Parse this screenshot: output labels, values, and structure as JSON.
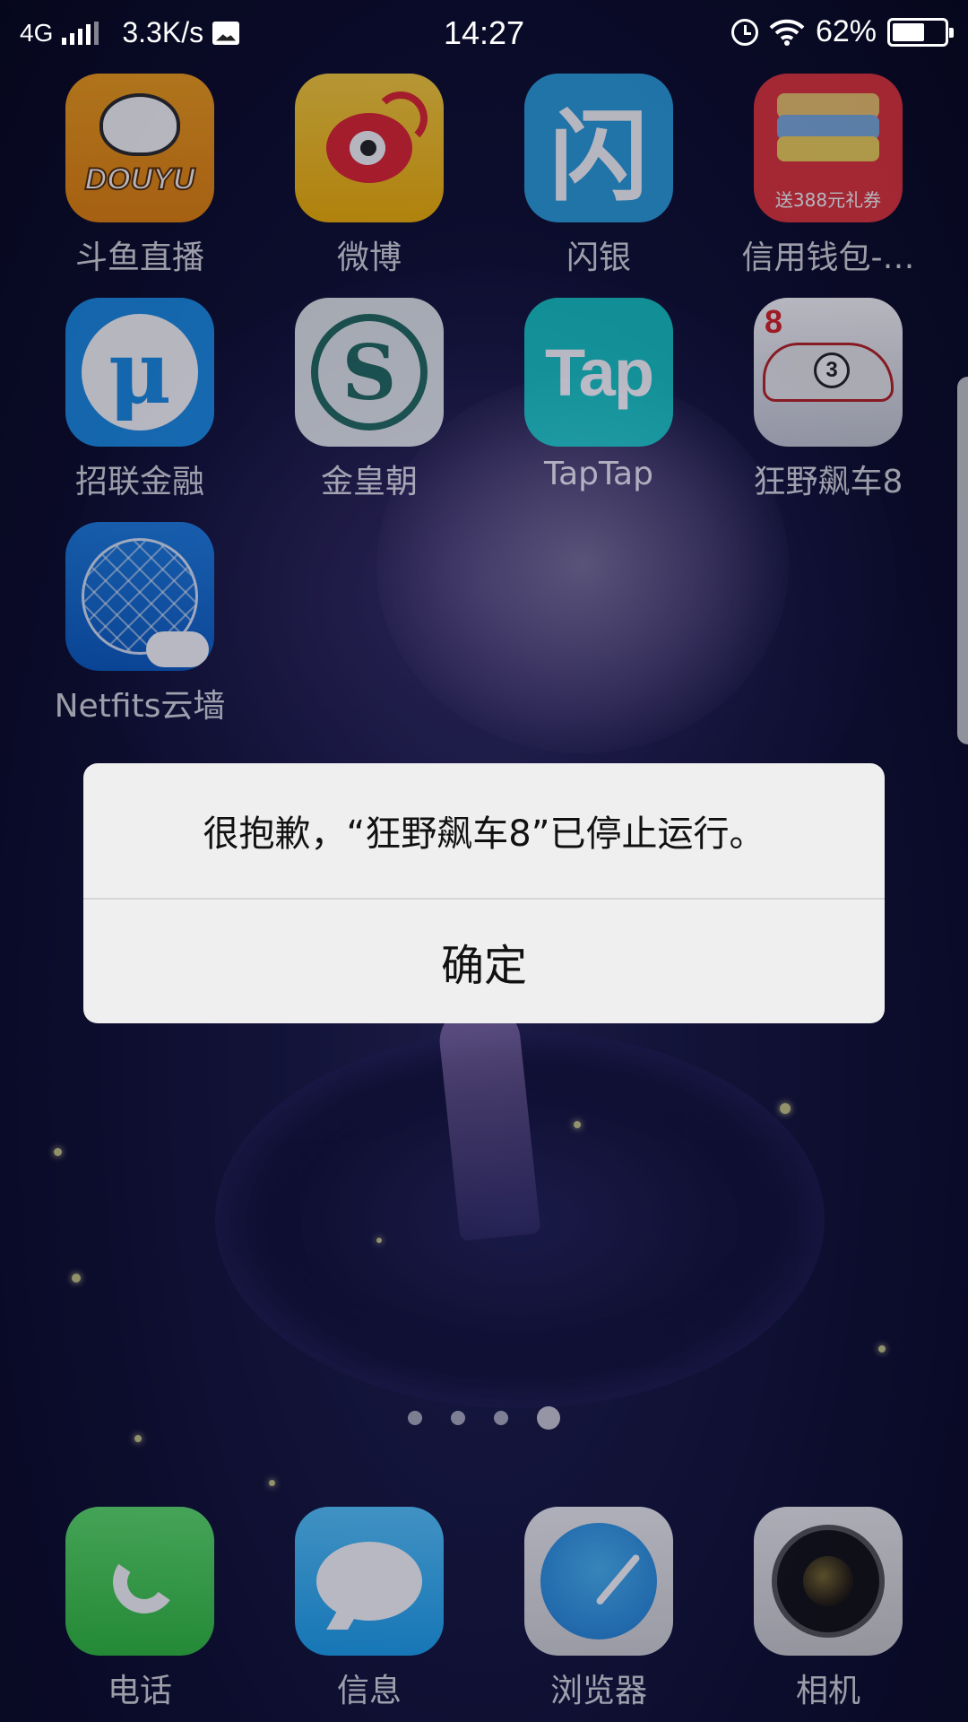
{
  "status_bar": {
    "network": "4G",
    "speed": "3.3K/s",
    "time": "14:27",
    "battery": "62%",
    "battery_level": 0.62
  },
  "apps": [
    {
      "label": "斗鱼直播",
      "icon": "douyu-icon",
      "glyph": "DOUYU"
    },
    {
      "label": "微博",
      "icon": "weibo-icon"
    },
    {
      "label": "闪银",
      "icon": "shanyin-icon",
      "glyph": "闪"
    },
    {
      "label": "信用钱包-…",
      "icon": "credit-wallet-icon",
      "glyph": "送388元礼券"
    },
    {
      "label": "招联金融",
      "icon": "zhaolian-icon",
      "glyph": "μ"
    },
    {
      "label": "金皇朝",
      "icon": "jinhuangchao-icon",
      "glyph": "S"
    },
    {
      "label": "TapTap",
      "icon": "taptap-icon",
      "glyph": "Tap"
    },
    {
      "label": "狂野飙车8",
      "icon": "asphalt8-icon",
      "glyph": "8"
    },
    {
      "label": "Netfits云墙",
      "icon": "netfits-icon"
    }
  ],
  "dock": [
    {
      "label": "电话",
      "icon": "phone-icon"
    },
    {
      "label": "信息",
      "icon": "messages-icon"
    },
    {
      "label": "浏览器",
      "icon": "browser-icon"
    },
    {
      "label": "相机",
      "icon": "camera-icon"
    }
  ],
  "page_indicator": {
    "count": 4,
    "active": 4
  },
  "dialog": {
    "message": "很抱歉，“狂野飙车8”已停止运行。",
    "confirm_label": "确定"
  }
}
